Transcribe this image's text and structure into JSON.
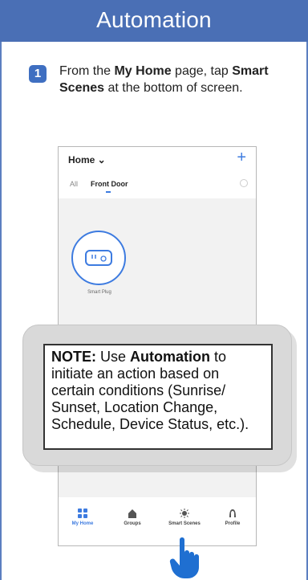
{
  "header": {
    "title": "Automation"
  },
  "step": {
    "number": "1",
    "text_pre": "From the ",
    "text_bold1": "My Home",
    "text_mid": " page, tap ",
    "text_bold2": "Smart Scenes",
    "text_post": " at the bottom of screen."
  },
  "phone": {
    "home_title": "Home ⌄",
    "add_symbol": "+",
    "tabs": {
      "all": "All",
      "front_door": "Front Door"
    },
    "device_label": "Smart Plug",
    "bottom_tabs": [
      {
        "label": "My Home",
        "icon": "grid-icon"
      },
      {
        "label": "Groups",
        "icon": "house-icon"
      },
      {
        "label": "Smart Scenes",
        "icon": "sun-icon"
      },
      {
        "label": "Profile",
        "icon": "person-icon"
      }
    ]
  },
  "note": {
    "label": "NOTE:",
    "pre": " Use ",
    "bold": "Automation",
    "post": " to initiate an action based on certain conditions (Sunrise/ Sunset, Location Change, Schedule, Device Status, etc.)."
  },
  "colors": {
    "header_bg": "#4a6fb5",
    "accent": "#3d7be0",
    "badge": "#3f6fc1"
  }
}
